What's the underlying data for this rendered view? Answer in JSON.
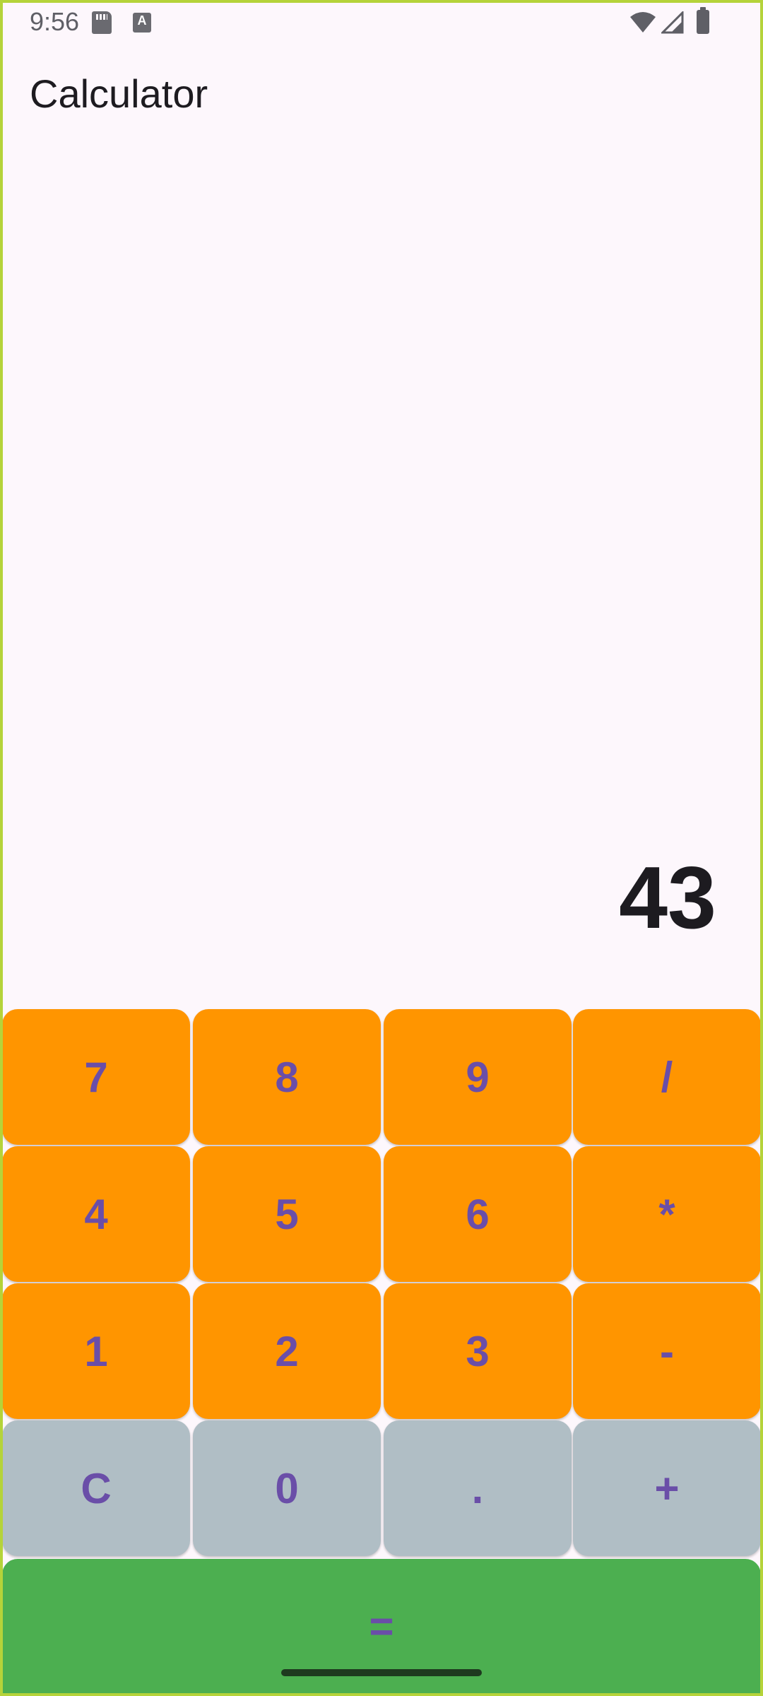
{
  "status_bar": {
    "time": "9:56",
    "a_icon_label": "A"
  },
  "app": {
    "title": "Calculator"
  },
  "display": {
    "value": "43"
  },
  "keys": {
    "row1": [
      "7",
      "8",
      "9",
      "/"
    ],
    "row2": [
      "4",
      "5",
      "6",
      "*"
    ],
    "row3": [
      "1",
      "2",
      "3",
      "-"
    ],
    "row4": [
      "C",
      "0",
      ".",
      "+"
    ],
    "equals": "="
  },
  "colors": {
    "digit_keys": "#ff9500",
    "bottom_row_keys": "#b0bec5",
    "equals_key": "#4caf50",
    "key_text": "#6a4ea8",
    "background": "#fdf7fc"
  }
}
